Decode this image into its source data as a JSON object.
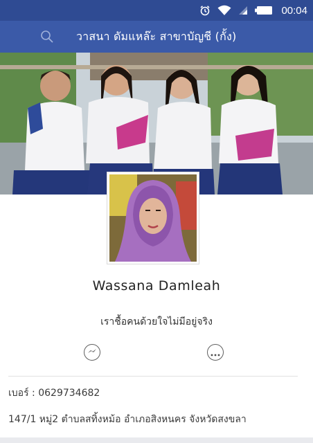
{
  "status_bar": {
    "time": "00:04",
    "icons": [
      "alarm-icon",
      "wifi-icon",
      "signal-icon",
      "battery-icon"
    ]
  },
  "nav": {
    "search_icon": "search-icon",
    "title": "วาสนา ดัมแหล๊ะ  สาขาบัญชี  (กั้ง)"
  },
  "profile": {
    "name": "Wassana Damleah",
    "bio": "เราชื้อคนด้วยใจไม่มีอยู่จริง"
  },
  "actions": {
    "messenger_icon": "messenger-icon",
    "more_icon": "more-icon"
  },
  "info": {
    "phone": "เบอร์ : 0629734682",
    "address": "147/1 หมู่2 ตำบลสทิ้งหม้อ  อำเภอสิงหนคร จังหวัดสงขลา"
  },
  "colors": {
    "status_bar": "#2f4b93",
    "nav_bar": "#3b5aa8"
  }
}
